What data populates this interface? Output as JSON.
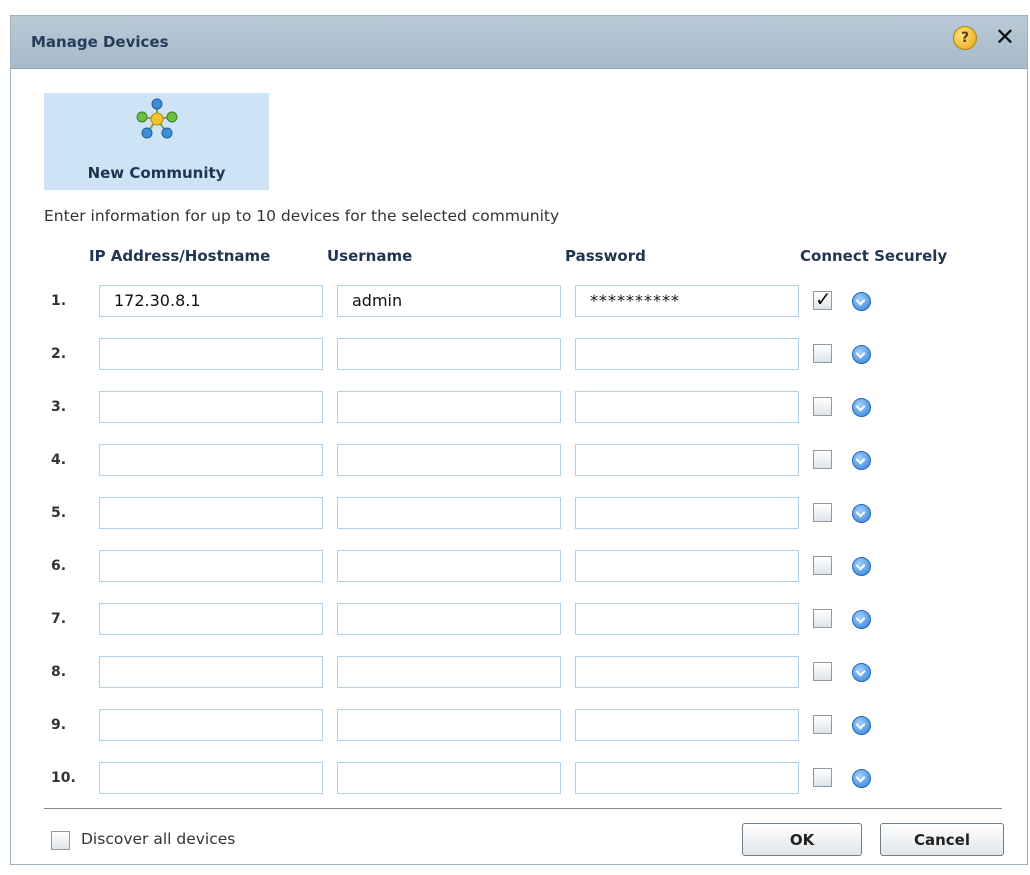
{
  "dialog": {
    "title": "Manage Devices",
    "help_icon": "?",
    "close_icon": "✕"
  },
  "community": {
    "label": "New Community",
    "icon": "network-community-icon"
  },
  "instructions": "Enter information for up to 10 devices for the selected community",
  "columns": {
    "ip": "IP Address/Hostname",
    "username": "Username",
    "password": "Password",
    "secure": "Connect Securely"
  },
  "rows": [
    {
      "num": "1.",
      "ip": "172.30.8.1",
      "username": "admin",
      "password": "**********",
      "secure": true
    },
    {
      "num": "2.",
      "ip": "",
      "username": "",
      "password": "",
      "secure": false
    },
    {
      "num": "3.",
      "ip": "",
      "username": "",
      "password": "",
      "secure": false
    },
    {
      "num": "4.",
      "ip": "",
      "username": "",
      "password": "",
      "secure": false
    },
    {
      "num": "5.",
      "ip": "",
      "username": "",
      "password": "",
      "secure": false
    },
    {
      "num": "6.",
      "ip": "",
      "username": "",
      "password": "",
      "secure": false
    },
    {
      "num": "7.",
      "ip": "",
      "username": "",
      "password": "",
      "secure": false
    },
    {
      "num": "8.",
      "ip": "",
      "username": "",
      "password": "",
      "secure": false
    },
    {
      "num": "9.",
      "ip": "",
      "username": "",
      "password": "",
      "secure": false
    },
    {
      "num": "10.",
      "ip": "",
      "username": "",
      "password": "",
      "secure": false
    }
  ],
  "footer": {
    "discover_label": "Discover all devices",
    "discover_checked": false,
    "ok": "OK",
    "cancel": "Cancel"
  },
  "colors": {
    "titlebar": "#b0c2d0",
    "tile": "#cfe3f6",
    "field_border": "#aed1ec",
    "accent": "#2f7ed8"
  }
}
